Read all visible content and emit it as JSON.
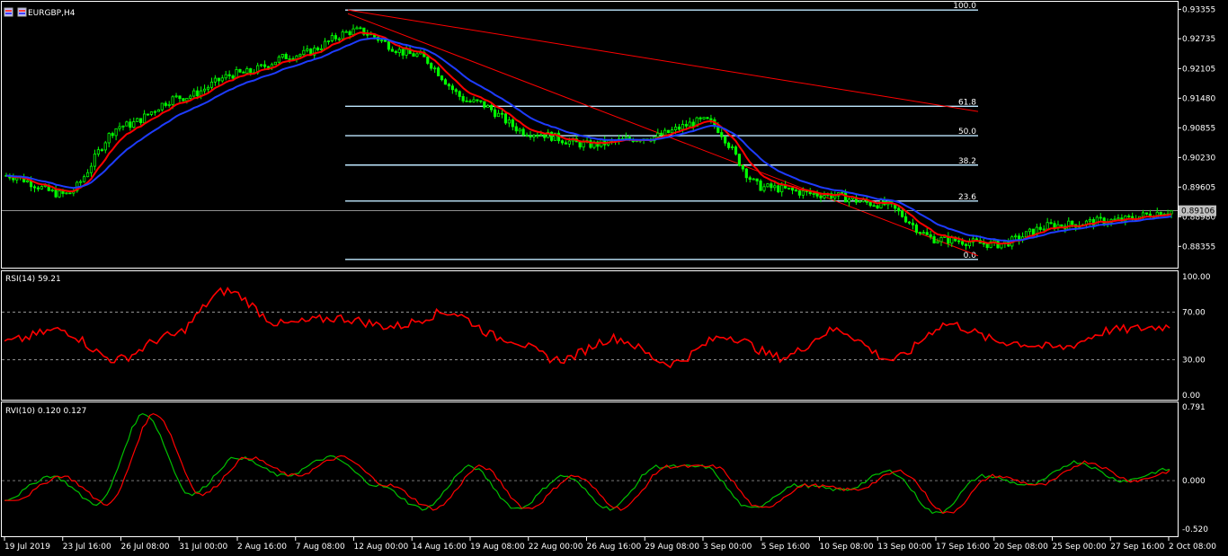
{
  "window": {
    "symbol_label": "EURGBP,H4",
    "icon": "window-flag-icon"
  },
  "colors": {
    "background": "#000000",
    "bull_candle": "#00ff00",
    "bear_candle": "#00ff00",
    "ema_fast": "#ff0000",
    "ema_slow": "#1e3cff",
    "fib_lines": "#bfe8ff",
    "trend_line": "#ff0000",
    "rsi_line": "#ff0000",
    "rvi_main": "#00c000",
    "rvi_signal": "#ff0000",
    "grid_dashed": "#c0c0c0",
    "current_price_line": "#c0c0c0"
  },
  "chart_data": [
    {
      "type": "candlestick",
      "title": "EURGBP,H4",
      "price_axis_ticks": [
        "0.93355",
        "0.92735",
        "0.92105",
        "0.91480",
        "0.90855",
        "0.90230",
        "0.89605",
        "0.88980",
        "0.88355"
      ],
      "ylim": [
        0.88,
        0.934
      ],
      "current_price": "0.89106",
      "overlays": [
        "EMA fast (red)",
        "EMA slow (blue)"
      ],
      "fibonacci": {
        "levels": [
          {
            "label": "100.0",
            "price": 0.9334
          },
          {
            "label": "61.8",
            "price": 0.9131
          },
          {
            "label": "50.0",
            "price": 0.9069
          },
          {
            "label": "38.2",
            "price": 0.9007
          },
          {
            "label": "23.6",
            "price": 0.8931
          },
          {
            "label": "0.0",
            "price": 0.8808
          }
        ]
      },
      "anchors": [
        {
          "date": "19 Jul 2019",
          "price": 0.8985
        },
        {
          "date": "23 Jul 16:00",
          "price": 0.8945
        },
        {
          "date": "26 Jul 08:00",
          "price": 0.909
        },
        {
          "date": "31 Jul 00:00",
          "price": 0.915
        },
        {
          "date": "2 Aug 16:00",
          "price": 0.92
        },
        {
          "date": "7 Aug 08:00",
          "price": 0.924
        },
        {
          "date": "12 Aug 00:00",
          "price": 0.929
        },
        {
          "date": "14 Aug 16:00",
          "price": 0.924
        },
        {
          "date": "19 Aug 08:00",
          "price": 0.914
        },
        {
          "date": "22 Aug 00:00",
          "price": 0.9075
        },
        {
          "date": "26 Aug 16:00",
          "price": 0.905
        },
        {
          "date": "29 Aug 08:00",
          "price": 0.9065
        },
        {
          "date": "3 Sep 00:00",
          "price": 0.91
        },
        {
          "date": "5 Sep 16:00",
          "price": 0.896
        },
        {
          "date": "10 Sep 08:00",
          "price": 0.8945
        },
        {
          "date": "13 Sep 00:00",
          "price": 0.8925
        },
        {
          "date": "17 Sep 16:00",
          "price": 0.885
        },
        {
          "date": "20 Sep 08:00",
          "price": 0.884
        },
        {
          "date": "25 Sep 00:00",
          "price": 0.888
        },
        {
          "date": "27 Sep 16:00",
          "price": 0.889
        },
        {
          "date": "2 Oct 08:00",
          "price": 0.891
        }
      ]
    },
    {
      "type": "line",
      "title": "RSI(14) 59.21",
      "ylim": [
        0,
        100
      ],
      "y_ticks": [
        "100.00",
        "70.00",
        "30.00",
        "0.00"
      ],
      "levels": [
        70,
        30
      ],
      "anchors": [
        45,
        55,
        30,
        50,
        88,
        60,
        65,
        58,
        70,
        48,
        30,
        48,
        27,
        50,
        32,
        55,
        30,
        60,
        45,
        40,
        55,
        58
      ]
    },
    {
      "type": "line",
      "title": "RVI(10) 0.120 0.127",
      "ylim": [
        -0.52,
        0.791
      ],
      "y_ticks": [
        "0.791",
        "0.000",
        "-0.520"
      ],
      "levels": [
        0
      ],
      "anchors": [
        -0.2,
        0.05,
        -0.25,
        0.72,
        -0.15,
        0.25,
        0.05,
        0.25,
        -0.05,
        -0.3,
        0.15,
        -0.3,
        0.05,
        -0.3,
        0.15,
        0.15,
        -0.3,
        -0.05,
        -0.1,
        0.1,
        -0.35,
        0.05,
        -0.05,
        0.2,
        0.0,
        0.12
      ]
    }
  ],
  "time_axis": {
    "labels": [
      "19 Jul 2019",
      "23 Jul 16:00",
      "26 Jul 08:00",
      "31 Jul 00:00",
      "2 Aug 16:00",
      "7 Aug 08:00",
      "12 Aug 00:00",
      "14 Aug 16:00",
      "19 Aug 08:00",
      "22 Aug 00:00",
      "26 Aug 16:00",
      "29 Aug 08:00",
      "3 Sep 00:00",
      "5 Sep 16:00",
      "10 Sep 08:00",
      "13 Sep 00:00",
      "17 Sep 16:00",
      "20 Sep 08:00",
      "25 Sep 00:00",
      "27 Sep 16:00",
      "2 Oct 08:00"
    ]
  }
}
